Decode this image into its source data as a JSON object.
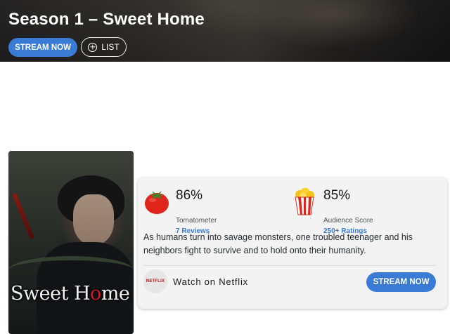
{
  "header": {
    "title": "Season 1 – Sweet Home",
    "stream_button": "STREAM NOW",
    "list_button": "LIST"
  },
  "poster": {
    "title_before": "Sweet H",
    "title_o": "o",
    "title_after": "me"
  },
  "scores": {
    "tomatometer": {
      "percent": "86%",
      "label": "Tomatometer",
      "link": "7 Reviews",
      "icon": "tomato-icon"
    },
    "audience": {
      "percent": "85%",
      "label": "Audience Score",
      "link": "250+ Ratings",
      "icon": "popcorn-icon"
    }
  },
  "synopsis": "As humans turn into savage monsters, one troubled teenager and his neighbors fight to survive and to hold onto their humanity.",
  "watch": {
    "provider_logo": "NETFLIX",
    "text": "Watch on Netflix",
    "stream_button": "STREAM NOW"
  },
  "colors": {
    "accent_blue": "#3a7bd5",
    "tomato_red": "#e0261c",
    "netflix_red": "#c11119"
  }
}
